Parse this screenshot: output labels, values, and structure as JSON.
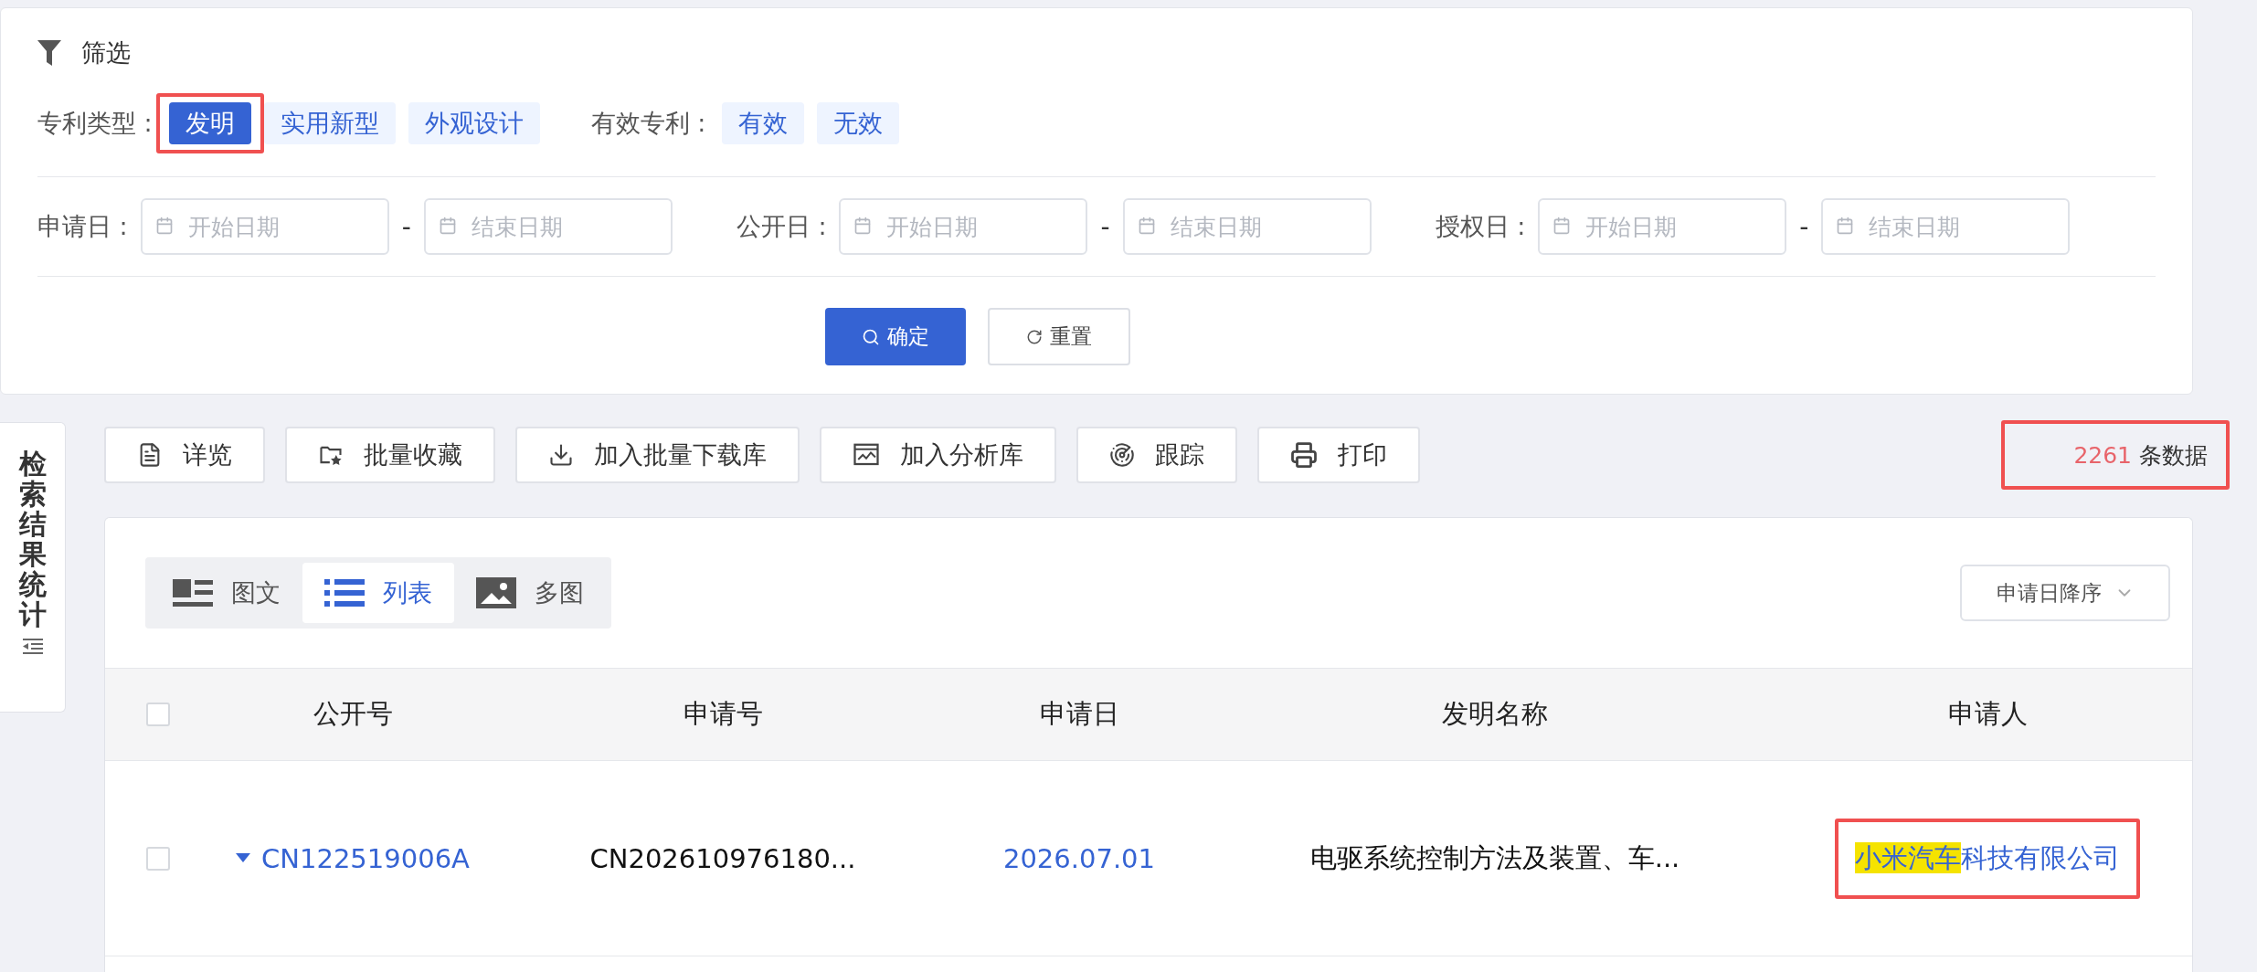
{
  "filter": {
    "title": "筛选",
    "groups": [
      {
        "label": "专利类型 :",
        "options": [
          {
            "label": "发明",
            "selected": true,
            "annotated": true
          },
          {
            "label": "实用新型",
            "selected": false,
            "annotated": false
          },
          {
            "label": "外观设计",
            "selected": false,
            "annotated": false
          }
        ]
      },
      {
        "label": "有效专利 :",
        "options": [
          {
            "label": "有效",
            "selected": false,
            "annotated": false
          },
          {
            "label": "无效",
            "selected": false,
            "annotated": false
          }
        ]
      }
    ],
    "date_ranges": [
      {
        "label": "申请日 :",
        "start_placeholder": "开始日期",
        "separator": "-",
        "end_placeholder": "结束日期"
      },
      {
        "label": "公开日 :",
        "start_placeholder": "开始日期",
        "separator": "-",
        "end_placeholder": "结束日期"
      },
      {
        "label": "授权日 :",
        "start_placeholder": "开始日期",
        "separator": "-",
        "end_placeholder": "结束日期"
      }
    ],
    "buttons": [
      {
        "label": "确定",
        "kind": "primary"
      },
      {
        "label": "重置",
        "kind": "reset"
      }
    ]
  },
  "side_tab": {
    "label": "检索结果统计"
  },
  "toolbar": [
    {
      "label": "详览",
      "kind": "document"
    },
    {
      "label": "批量收藏",
      "kind": "folder-star"
    },
    {
      "label": "加入批量下载库",
      "kind": "download"
    },
    {
      "label": "加入分析库",
      "kind": "chart"
    },
    {
      "label": "跟踪",
      "kind": "radar"
    },
    {
      "label": "打印",
      "kind": "print"
    }
  ],
  "result_count": {
    "count": "2261",
    "label": "条数据",
    "annotated": true
  },
  "view_tabs": [
    {
      "label": "图文",
      "kind": "article",
      "selected": false
    },
    {
      "label": "列表",
      "kind": "list",
      "selected": true
    },
    {
      "label": "多图",
      "kind": "image",
      "selected": false
    }
  ],
  "sort": {
    "value": "申请日降序"
  },
  "table": {
    "columns": [
      "公开号",
      "申请号",
      "申请日",
      "发明名称",
      "申请人"
    ],
    "header_checked": false,
    "rows": [
      {
        "checked": false,
        "pub_no": "CN122519006A",
        "app_no": "CN202610976180...",
        "date": "2026.07.01",
        "title": "电驱系统控制方法及装置、车...",
        "applicant": {
          "highlight": "小米汽车",
          "rest": "科技有限公司",
          "annotated": true
        }
      }
    ]
  }
}
